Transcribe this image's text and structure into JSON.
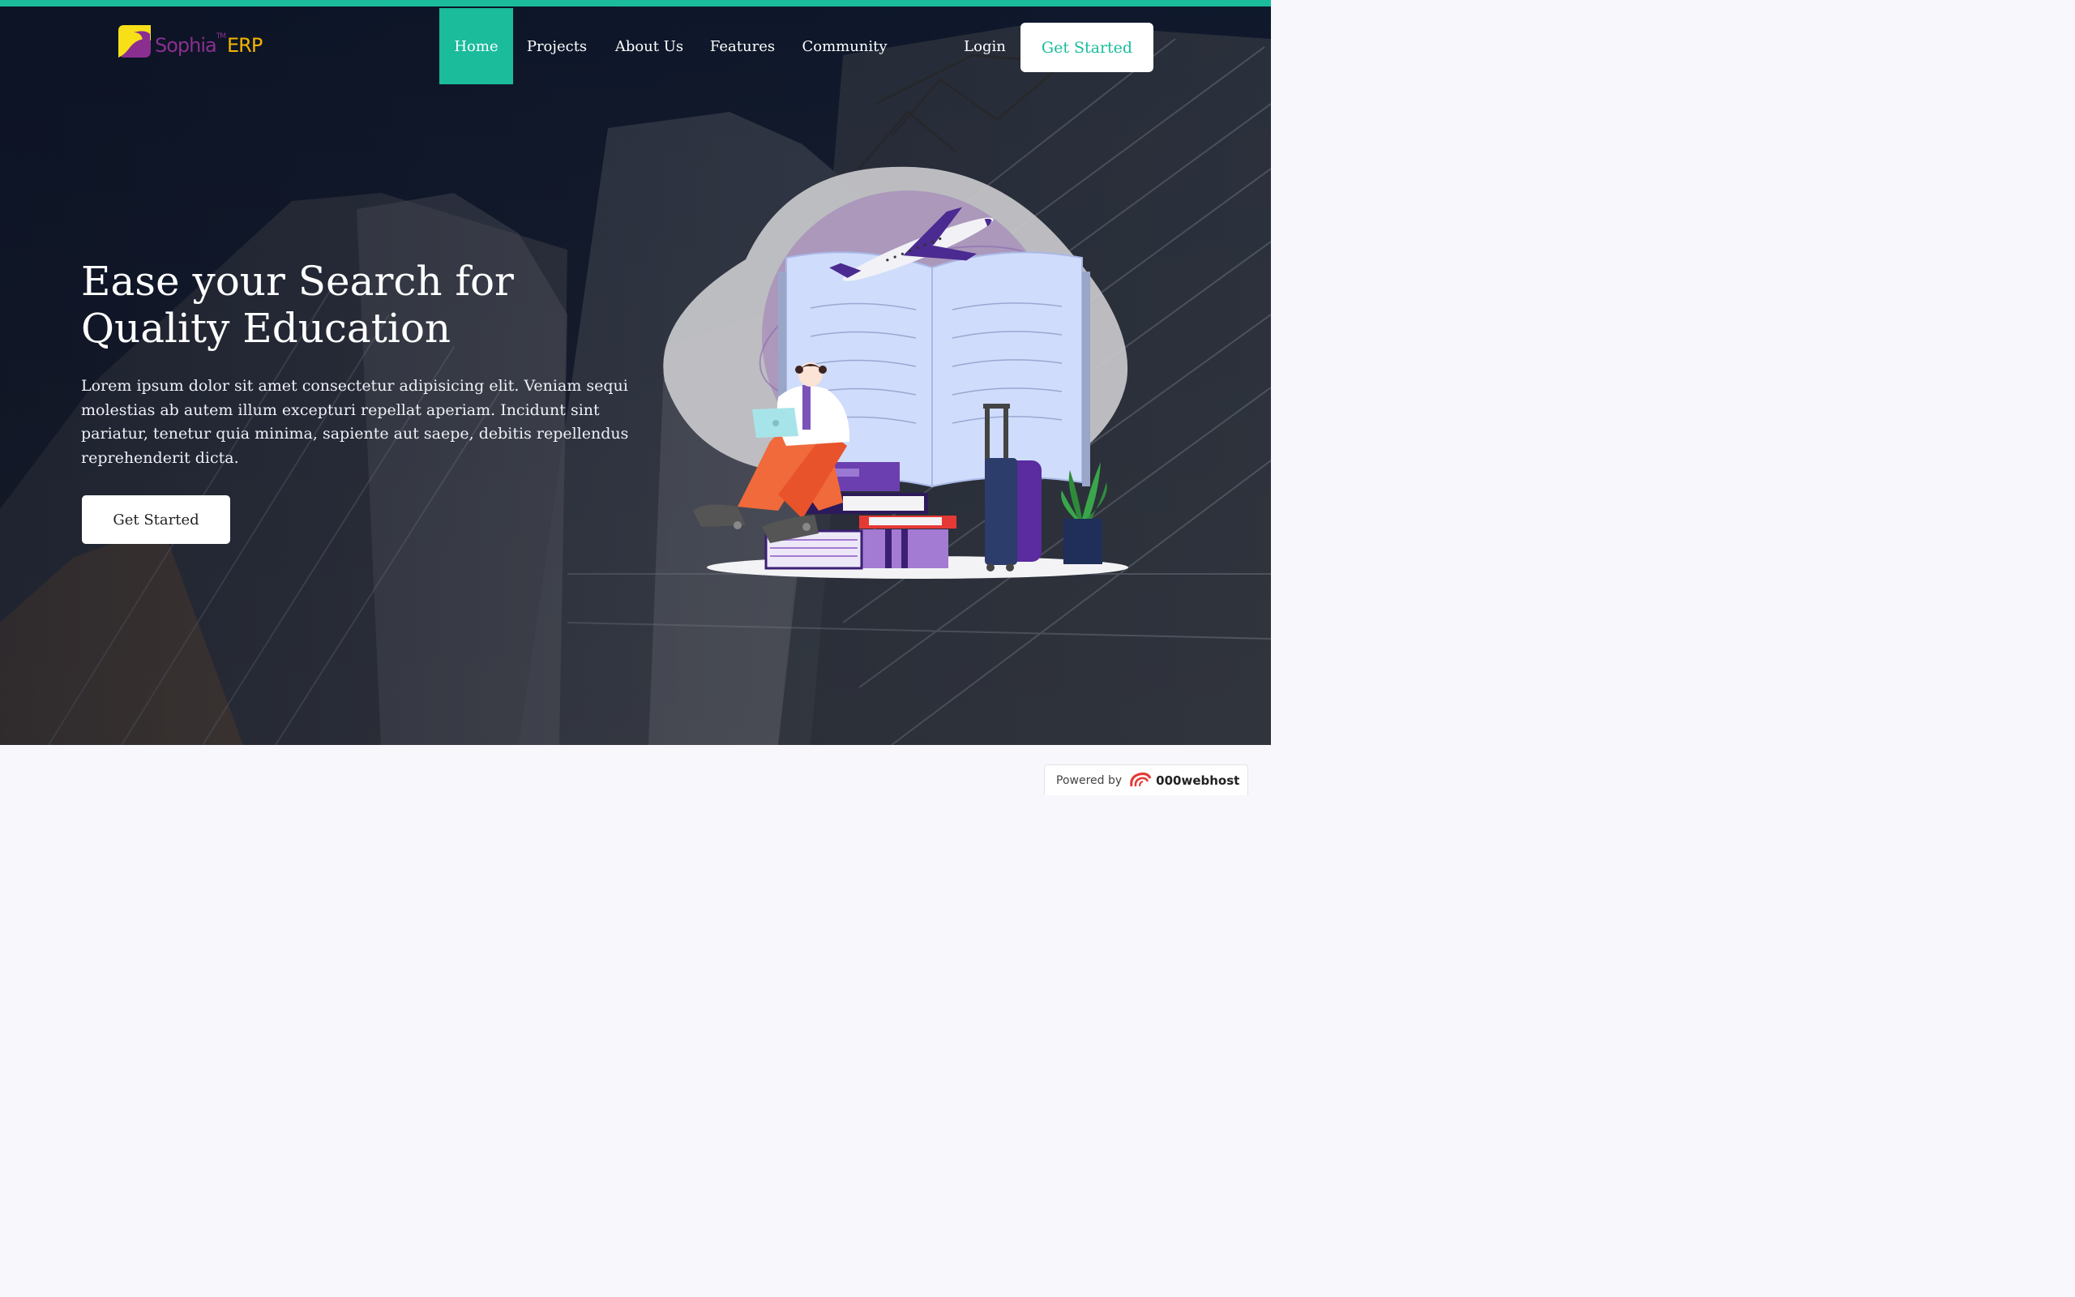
{
  "brand": {
    "name": "Sophia",
    "trademark": "TM",
    "suffix": "ERP",
    "colors": {
      "accent": "#1abc9c",
      "sophia": "#8a2f8f",
      "erp": "#f4b400"
    }
  },
  "nav": {
    "items": [
      {
        "label": "Home",
        "active": true
      },
      {
        "label": "Projects",
        "active": false
      },
      {
        "label": "About Us",
        "active": false
      },
      {
        "label": "Features",
        "active": false
      },
      {
        "label": "Community",
        "active": false
      }
    ],
    "login": "Login",
    "cta": "Get Started"
  },
  "hero": {
    "title_line1": "Ease your Search for",
    "title_line2": "Quality Education",
    "description": "Lorem ipsum dolor sit amet consectetur adipisicing elit. Veniam sequi molestias ab autem illum excepturi repellat aperiam. Incidunt sint pariatur, tenetur quia minima, sapiente aut saepe, debitis repellendus reprehenderit dicta.",
    "cta": "Get Started",
    "illustration_icon": "student-with-books-airplane-illustration"
  },
  "badge": {
    "label": "Powered by",
    "brand": "000webhost",
    "icon": "000webhost-logo-icon"
  }
}
